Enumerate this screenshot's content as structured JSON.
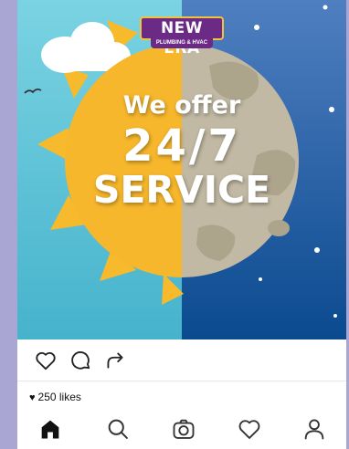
{
  "post": {
    "brand": {
      "name": "NEW ERA",
      "tagline": "PLUMBING & HVAC"
    },
    "headline": {
      "line1": "We offer",
      "line2": "24/7",
      "line3": "SERVICE"
    }
  },
  "engagement": {
    "likes": "250 likes"
  },
  "icons": {
    "like": "heart-outline-icon",
    "comment": "comment-bubble-icon",
    "share": "share-arrow-icon",
    "likes_badge": "heart-filled-icon"
  },
  "nav": {
    "items": [
      {
        "id": "home",
        "icon": "home-icon",
        "active": true
      },
      {
        "id": "search",
        "icon": "search-icon",
        "active": false
      },
      {
        "id": "camera",
        "icon": "camera-icon",
        "active": false
      },
      {
        "id": "activity",
        "icon": "heart-outline-icon",
        "active": false
      },
      {
        "id": "profile",
        "icon": "profile-icon",
        "active": false
      }
    ]
  },
  "colors": {
    "day_sky": "#5bc3d8",
    "night_sky": "#0e4d93",
    "sun": "#f6b325",
    "moon": "#c1b9a3",
    "brand_purple": "#6b2a86"
  }
}
